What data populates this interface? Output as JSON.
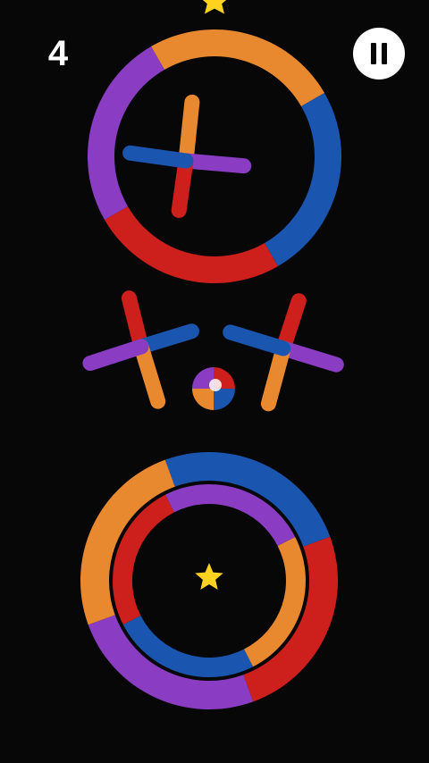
{
  "hud": {
    "score": "4",
    "pause_icon": "pause-icon"
  },
  "palette": {
    "background": "#070707",
    "purple": "#8a3cc3",
    "orange": "#e8892f",
    "blue": "#1a56b0",
    "red": "#cd1f1c",
    "star": "#ffd21f"
  },
  "game": {
    "top_ring_colors": [
      "orange",
      "blue",
      "red",
      "purple"
    ],
    "double_ring_outer_colors": [
      "blue",
      "red",
      "purple",
      "orange"
    ],
    "double_ring_inner_colors": [
      "orange",
      "blue",
      "red",
      "purple"
    ],
    "cross_arm_colors": [
      "orange",
      "purple",
      "red",
      "blue"
    ],
    "ball_colors": [
      "purple",
      "red",
      "orange",
      "blue"
    ],
    "collectible_stars": 2
  }
}
